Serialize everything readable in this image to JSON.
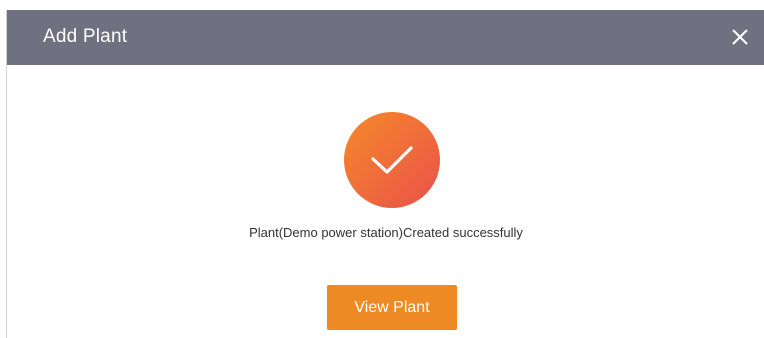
{
  "dialog": {
    "title": "Add Plant",
    "close_icon": "close-icon",
    "success_icon": "checkmark-icon",
    "message": "Plant(Demo power station)Created successfully",
    "primary_button_label": "View Plant"
  },
  "colors": {
    "header_background": "#6f7181",
    "accent": "#ee8a24",
    "success_gradient_start": "#f58a2a",
    "success_gradient_end": "#e9504a",
    "message_text": "#333333"
  }
}
